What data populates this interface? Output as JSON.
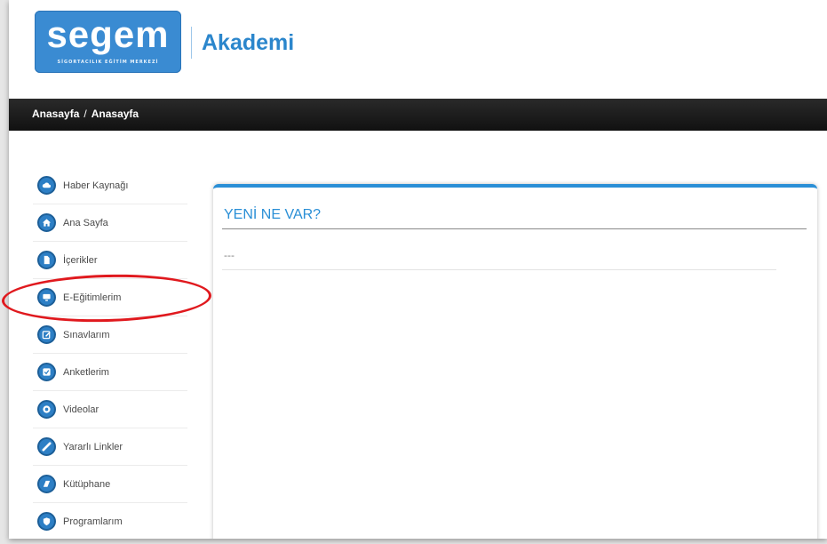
{
  "header": {
    "logo_text": "segem",
    "logo_subtitle": "SİGORTACILIK EĞİTİM MERKEZİ",
    "site_name": "Akademi"
  },
  "breadcrumb": [
    "Anasayfa",
    "Anasayfa"
  ],
  "breadcrumb_separator": "/",
  "sidebar": {
    "items": [
      {
        "label": "Haber Kaynağı",
        "icon": "cloud-icon"
      },
      {
        "label": "Ana Sayfa",
        "icon": "home-icon"
      },
      {
        "label": "İçerikler",
        "icon": "document-icon"
      },
      {
        "label": "E-Eğitimlerim",
        "icon": "monitor-icon"
      },
      {
        "label": "Sınavlarım",
        "icon": "edit-icon"
      },
      {
        "label": "Anketlerim",
        "icon": "checklist-icon"
      },
      {
        "label": "Videolar",
        "icon": "play-icon"
      },
      {
        "label": "Yararlı Linkler",
        "icon": "link-icon"
      },
      {
        "label": "Kütüphane",
        "icon": "book-icon"
      },
      {
        "label": "Programlarım",
        "icon": "shield-icon"
      }
    ]
  },
  "main": {
    "title": "YENİ NE VAR?",
    "content": "---"
  },
  "colors": {
    "brand_blue": "#3a8bd2",
    "accent_blue": "#2a8fd6",
    "bar_dark": "#1a1a1a",
    "annotation_red": "#e0191e"
  }
}
